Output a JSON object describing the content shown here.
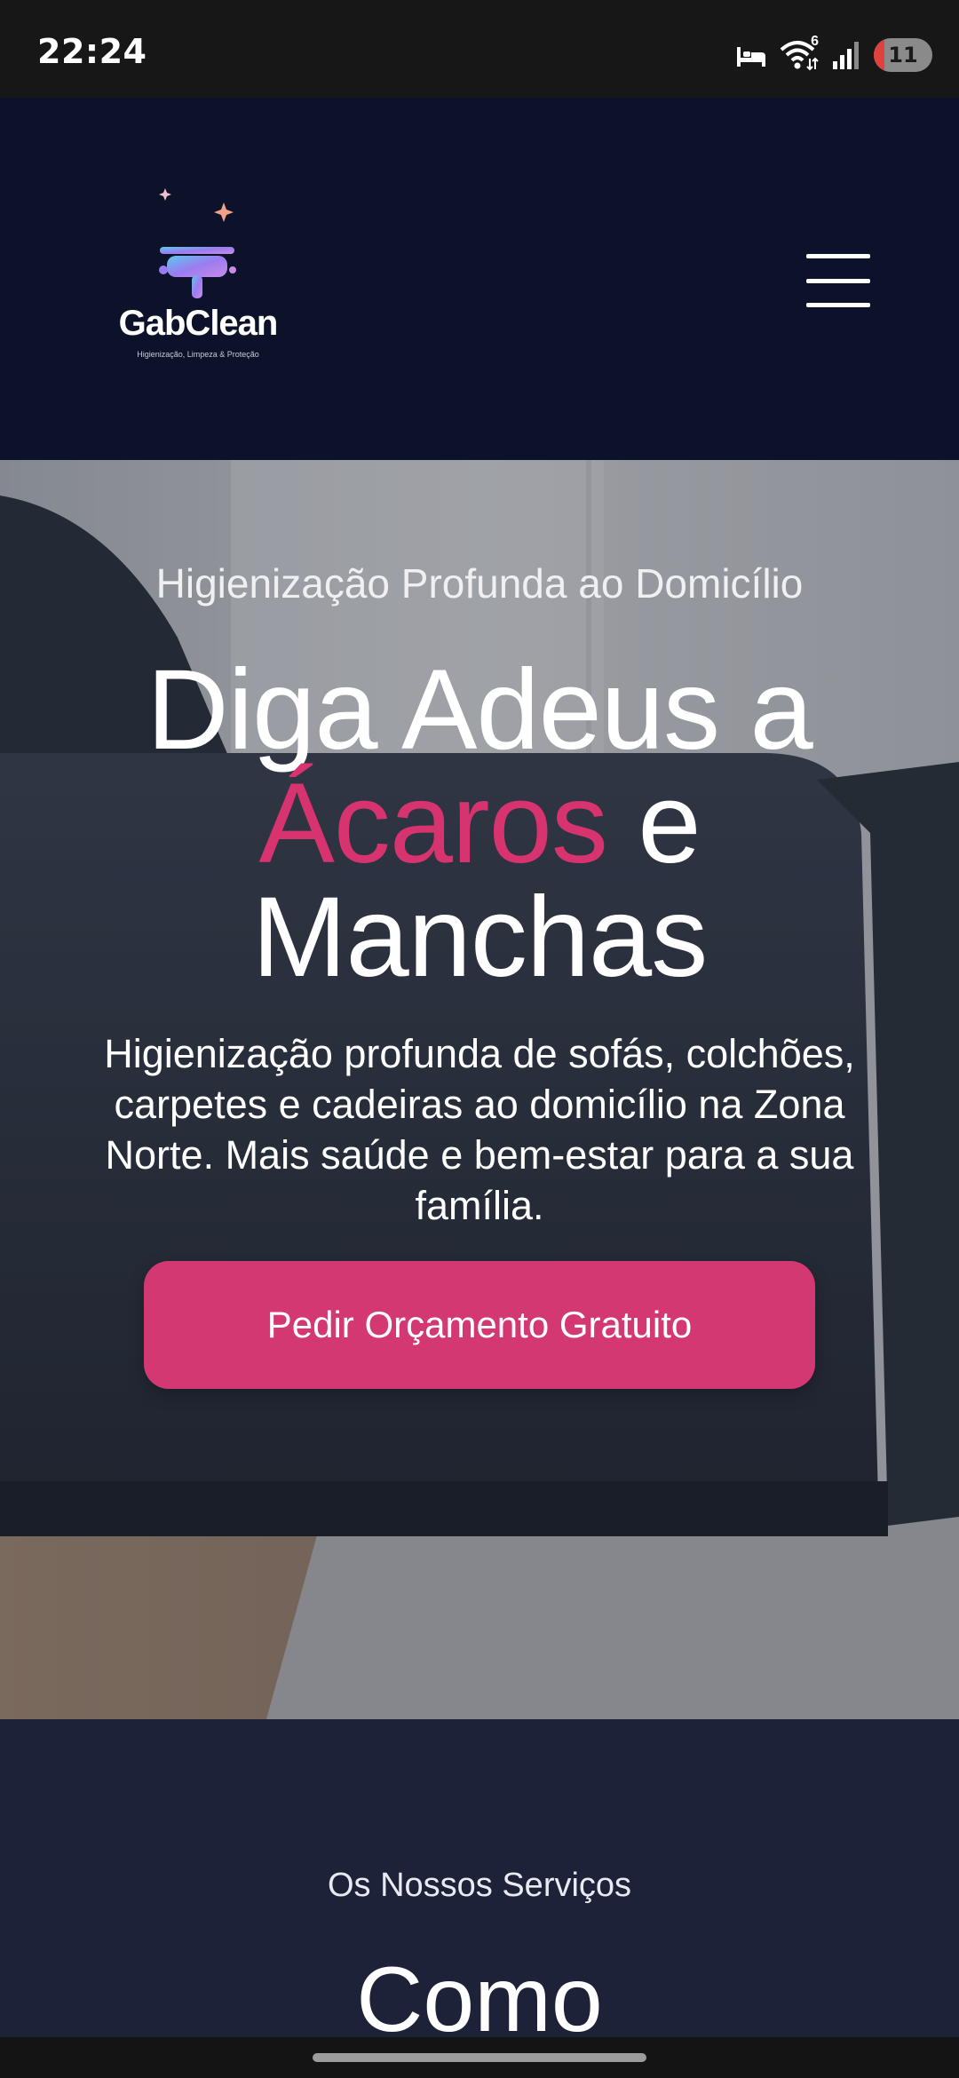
{
  "status_bar": {
    "time": "22:24",
    "wifi_badge": "6",
    "battery": "11",
    "icons": [
      "bed-icon",
      "wifi-icon",
      "signal-icon",
      "battery-icon"
    ]
  },
  "header": {
    "logo_name": "GabClean",
    "logo_tagline": "Higienização, Limpeza & Proteção",
    "menu_icon": "hamburger-menu-icon"
  },
  "hero": {
    "kicker": "Higienização Profunda ao Domicílio",
    "title_line1": "Diga Adeus a",
    "title_accent": "Ácaros",
    "title_after_accent": "e",
    "title_line3": "Manchas",
    "description": "Higienização profunda de sofás, colchões, carpetes e cadeiras ao domicílio na Zona Norte. Mais saúde e bem-estar para a sua família.",
    "cta_label": "Pedir Orçamento Gratuito"
  },
  "services": {
    "kicker": "Os Nossos Serviços",
    "title": "Como"
  },
  "colors": {
    "header_bg": "#0c1229",
    "accent_pink": "#d6336f",
    "cta_bg": "#d43873",
    "services_bg": "#1d2238"
  }
}
